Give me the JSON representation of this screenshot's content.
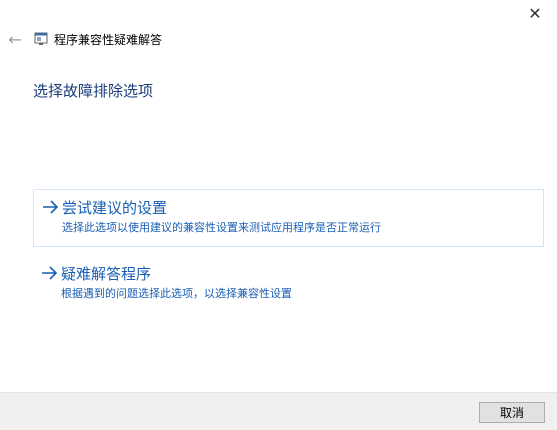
{
  "window": {
    "close_label": "✕"
  },
  "header": {
    "back_glyph": "←",
    "title": "程序兼容性疑难解答"
  },
  "main": {
    "heading": "选择故障排除选项",
    "options": [
      {
        "title": "尝试建议的设置",
        "description": "选择此选项以使用建议的兼容性设置来测试应用程序是否正常运行",
        "selected": true
      },
      {
        "title": "疑难解答程序",
        "description": "根据遇到的问题选择此选项，以选择兼容性设置",
        "selected": false
      }
    ]
  },
  "footer": {
    "cancel_label": "取消"
  },
  "colors": {
    "accent": "#1a5fb4",
    "heading": "#1a3d7a",
    "footer_bg": "#f0f0f0"
  },
  "icons": {
    "back": "back-arrow-icon",
    "app": "compatibility-troubleshooter-icon",
    "option": "right-arrow-icon",
    "close": "close-icon"
  }
}
